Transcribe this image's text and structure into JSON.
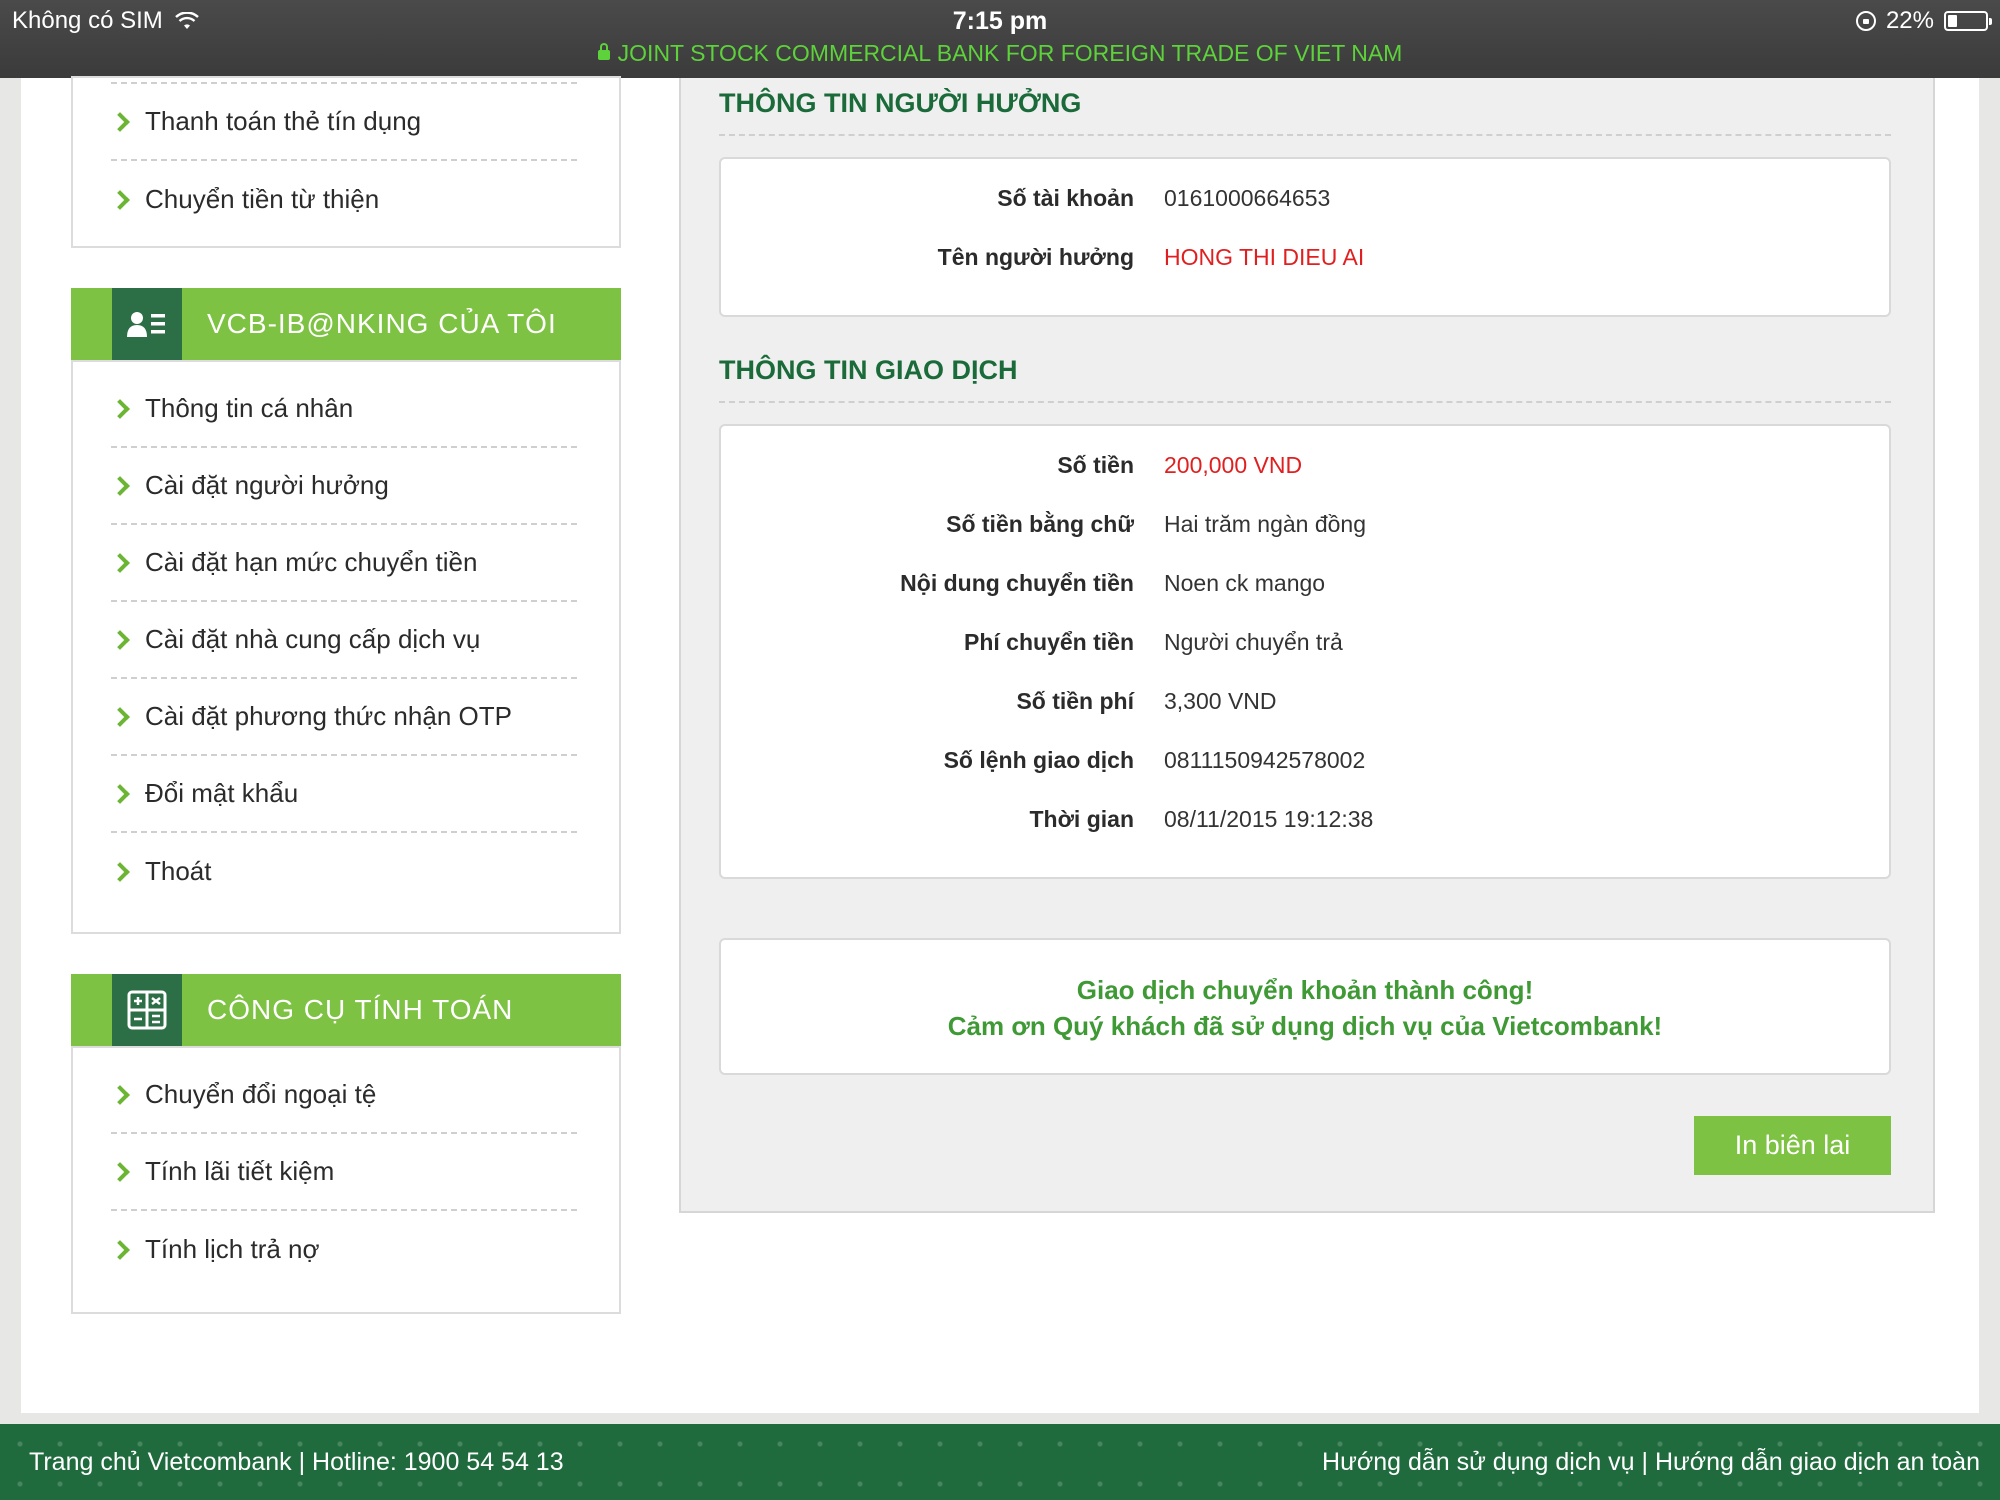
{
  "status_bar": {
    "carrier": "Không có SIM",
    "time": "7:15 pm",
    "battery": "22%",
    "battery_level": 0.22,
    "site_title": "JOINT STOCK COMMERCIAL BANK FOR FOREIGN TRADE OF VIET NAM"
  },
  "sidebar": {
    "top_items": [
      "Thanh toán thẻ tín dụng",
      "Chuyển tiền từ thiện"
    ],
    "my_ibanking": {
      "title": "VCB-IB@NKING CỦA TÔI",
      "items": [
        "Thông tin cá nhân",
        "Cài đặt người hưởng",
        "Cài đặt hạn mức chuyển tiền",
        "Cài đặt nhà cung cấp dịch vụ",
        "Cài đặt phương thức nhận OTP",
        "Đổi mật khẩu",
        "Thoát"
      ]
    },
    "tools": {
      "title": "CÔNG CỤ TÍNH TOÁN",
      "items": [
        "Chuyển đổi ngoại tệ",
        "Tính lãi tiết kiệm",
        "Tính lịch trả nợ"
      ]
    }
  },
  "beneficiary": {
    "title": "THÔNG TIN NGƯỜI HƯỞNG",
    "account_label": "Số tài khoản",
    "account_value": "0161000664653",
    "name_label": "Tên người hưởng",
    "name_value": "HONG THI DIEU AI"
  },
  "transaction": {
    "title": "THÔNG TIN GIAO DỊCH",
    "rows": [
      {
        "label": "Số tiền",
        "value": "200,000 VND"
      },
      {
        "label": "Số tiền bằng chữ",
        "value": "Hai trăm ngàn đồng"
      },
      {
        "label": "Nội dung chuyển tiền",
        "value": "Noen ck mango"
      },
      {
        "label": "Phí chuyển tiền",
        "value": "Người chuyển trả"
      },
      {
        "label": "Số tiền phí",
        "value": "3,300 VND"
      },
      {
        "label": "Số lệnh giao dịch",
        "value": "0811150942578002"
      },
      {
        "label": "Thời gian",
        "value": "08/11/2015 19:12:38"
      }
    ]
  },
  "success": {
    "line1": "Giao dịch chuyển khoản thành công!",
    "line2": "Cảm ơn Quý khách đã sử dụng dịch vụ của Vietcombank!"
  },
  "print_button": "In biên lai",
  "footer": {
    "left": "Trang chủ Vietcombank | Hotline: 1900 54 54 13",
    "right": "Hướng dẫn sử dụng dịch vụ |  Hướng dẫn giao dịch an toàn"
  },
  "colors": {
    "accent_green": "#7dc242",
    "dark_green": "#1f6b3e",
    "title_green": "#1b6b3a",
    "highlight_red": "#e02020"
  }
}
